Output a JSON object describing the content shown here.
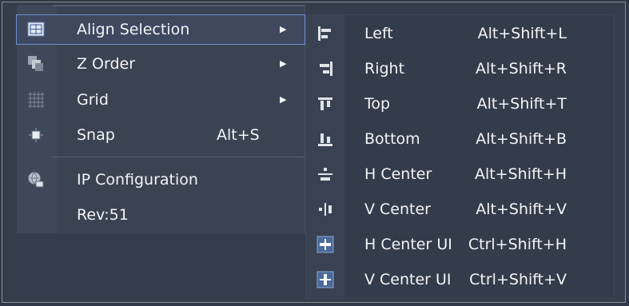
{
  "menu": {
    "items": [
      {
        "label": "Align Selection",
        "icon": "align-selection-icon",
        "has_submenu": true,
        "active": true
      },
      {
        "label": "Z Order",
        "icon": "z-order-icon",
        "has_submenu": true
      },
      {
        "label": "Grid",
        "icon": "grid-icon",
        "has_submenu": true
      },
      {
        "label": "Snap",
        "icon": "snap-icon",
        "shortcut": "Alt+S"
      },
      {
        "label": "IP Configuration",
        "icon": "ip-configuration-icon"
      },
      {
        "label": "Rev:51"
      }
    ]
  },
  "submenu": {
    "items": [
      {
        "label": "Left",
        "shortcut": "Alt+Shift+L",
        "icon": "align-left-icon"
      },
      {
        "label": "Right",
        "shortcut": "Alt+Shift+R",
        "icon": "align-right-icon"
      },
      {
        "label": "Top",
        "shortcut": "Alt+Shift+T",
        "icon": "align-top-icon"
      },
      {
        "label": "Bottom",
        "shortcut": "Alt+Shift+B",
        "icon": "align-bottom-icon"
      },
      {
        "label": "H Center",
        "shortcut": "Alt+Shift+H",
        "icon": "align-h-center-icon"
      },
      {
        "label": "V Center",
        "shortcut": "Alt+Shift+V",
        "icon": "align-v-center-icon"
      },
      {
        "label": "H Center UI",
        "shortcut": "Ctrl+Shift+H",
        "icon": "h-center-ui-icon"
      },
      {
        "label": "V Center UI",
        "shortcut": "Ctrl+Shift+V",
        "icon": "v-center-ui-icon"
      }
    ]
  },
  "colors": {
    "background": "#2f3846",
    "menu_bg": "#3a4352",
    "active_border": "#6d8fd4",
    "text": "#f2f4f7"
  }
}
